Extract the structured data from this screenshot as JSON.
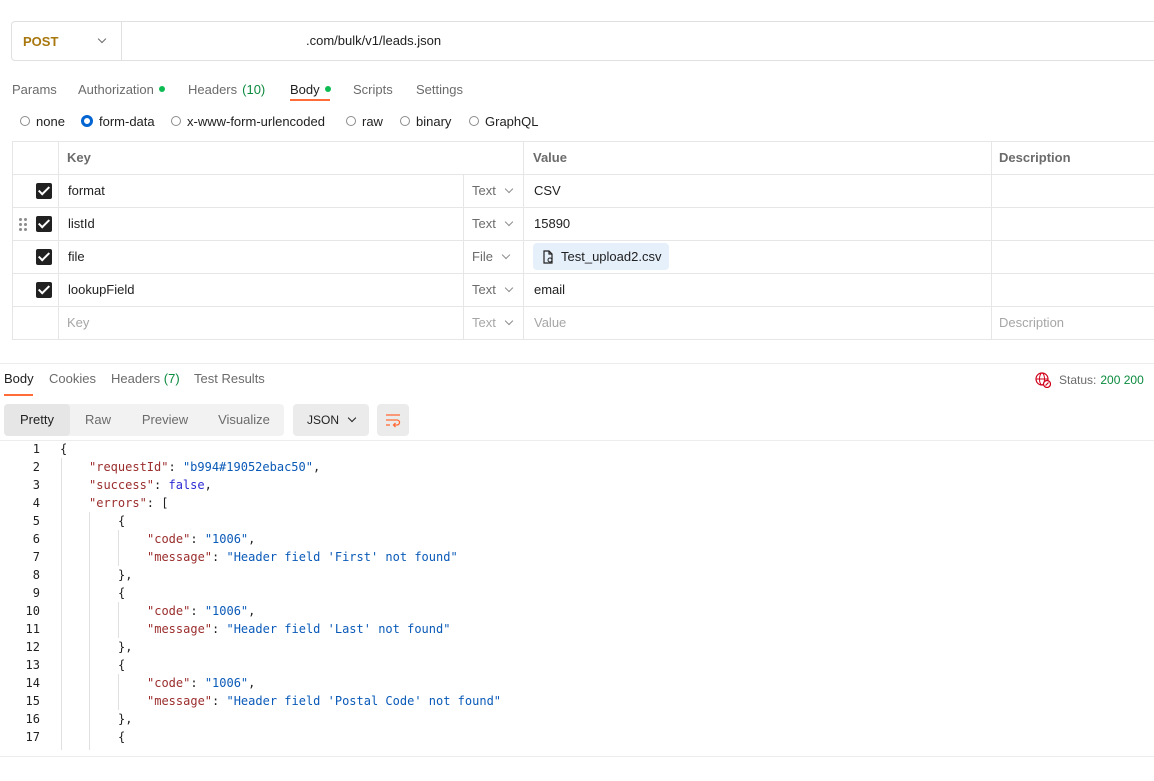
{
  "request": {
    "method": "POST",
    "url": ".com/bulk/v1/leads.json"
  },
  "tabs": [
    {
      "label": "Params",
      "dot": false
    },
    {
      "label": "Authorization",
      "dot": true
    },
    {
      "label": "Headers",
      "count": "(10)",
      "dot": false
    },
    {
      "label": "Body",
      "dot": true
    },
    {
      "label": "Scripts",
      "dot": false
    },
    {
      "label": "Settings",
      "dot": false
    }
  ],
  "body_types": [
    {
      "label": "none",
      "selected": false
    },
    {
      "label": "form-data",
      "selected": true
    },
    {
      "label": "x-www-form-urlencoded",
      "selected": false
    },
    {
      "label": "raw",
      "selected": false
    },
    {
      "label": "binary",
      "selected": false
    },
    {
      "label": "GraphQL",
      "selected": false
    }
  ],
  "table": {
    "headers": {
      "key": "Key",
      "value": "Value",
      "description": "Description"
    },
    "rows": [
      {
        "key": "format",
        "type": "Text",
        "value": "CSV"
      },
      {
        "key": "listId",
        "type": "Text",
        "value": "15890"
      },
      {
        "key": "file",
        "type": "File",
        "value": "Test_upload2.csv"
      },
      {
        "key": "lookupField",
        "type": "Text",
        "value": "email"
      }
    ],
    "empty_row": {
      "key": "Key",
      "type": "Text",
      "value": "Value",
      "description": "Description"
    }
  },
  "response": {
    "tabs": [
      {
        "label": "Body"
      },
      {
        "label": "Cookies"
      },
      {
        "label": "Headers",
        "count": "(7)"
      },
      {
        "label": "Test Results"
      }
    ],
    "status_label": "Status:",
    "status_value": "200 200",
    "views": [
      "Pretty",
      "Raw",
      "Preview",
      "Visualize"
    ],
    "format": "JSON",
    "code_lines": [
      {
        "n": "1",
        "text": "{"
      },
      {
        "n": "2",
        "key": "\"requestId\"",
        "val": "\"b994#19052ebac50\"",
        "tail": ","
      },
      {
        "n": "3",
        "key": "\"success\"",
        "bool": "false",
        "tail": ","
      },
      {
        "n": "4",
        "key": "\"errors\"",
        "tail": ": ["
      },
      {
        "n": "5",
        "text": "{"
      },
      {
        "n": "6",
        "key": "\"code\"",
        "val": "\"1006\"",
        "tail": ","
      },
      {
        "n": "7",
        "key": "\"message\"",
        "val": "\"Header field 'First' not found\"",
        "tail": ""
      },
      {
        "n": "8",
        "text": "},"
      },
      {
        "n": "9",
        "text": "{"
      },
      {
        "n": "10",
        "key": "\"code\"",
        "val": "\"1006\"",
        "tail": ","
      },
      {
        "n": "11",
        "key": "\"message\"",
        "val": "\"Header field 'Last' not found\"",
        "tail": ""
      },
      {
        "n": "12",
        "text": "},"
      },
      {
        "n": "13",
        "text": "{"
      },
      {
        "n": "14",
        "key": "\"code\"",
        "val": "\"1006\"",
        "tail": ","
      },
      {
        "n": "15",
        "key": "\"message\"",
        "val": "\"Header field 'Postal Code' not found\"",
        "tail": ""
      },
      {
        "n": "16",
        "text": "},"
      },
      {
        "n": "17",
        "text": "{"
      }
    ]
  },
  "colors": {
    "accent": "#ff6c37",
    "method": "#a8770e",
    "radio": "#0265d2",
    "status_ok": "#0b8a3e"
  }
}
